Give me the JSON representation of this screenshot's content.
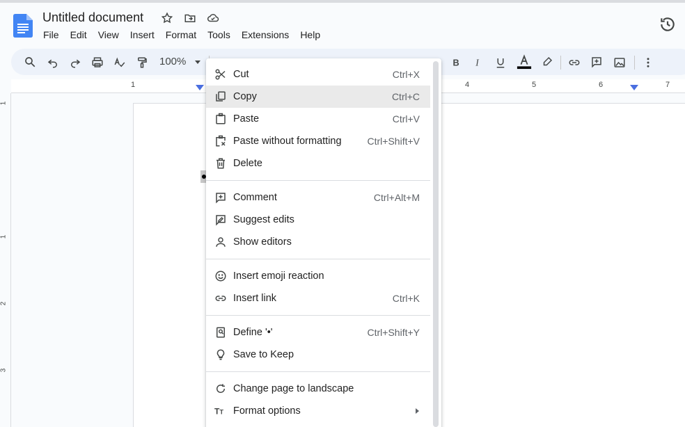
{
  "document": {
    "title": "Untitled document"
  },
  "menubar": [
    "File",
    "Edit",
    "View",
    "Insert",
    "Format",
    "Tools",
    "Extensions",
    "Help"
  ],
  "toolbar": {
    "zoom": "100%"
  },
  "ruler": {
    "numbers": [
      "1",
      "4",
      "5",
      "6",
      "7"
    ],
    "vnumbers": [
      "1",
      "1",
      "2",
      "3"
    ]
  },
  "context_menu": {
    "items": [
      {
        "label": "Cut",
        "shortcut": "Ctrl+X",
        "icon": "scissors-icon"
      },
      {
        "label": "Copy",
        "shortcut": "Ctrl+C",
        "icon": "copy-icon"
      },
      {
        "label": "Paste",
        "shortcut": "Ctrl+V",
        "icon": "paste-icon"
      },
      {
        "label": "Paste without formatting",
        "shortcut": "Ctrl+Shift+V",
        "icon": "paste-plain-icon"
      },
      {
        "label": "Delete",
        "shortcut": "",
        "icon": "trash-icon"
      },
      {
        "label": "Comment",
        "shortcut": "Ctrl+Alt+M",
        "icon": "add-comment-icon"
      },
      {
        "label": "Suggest edits",
        "shortcut": "",
        "icon": "suggest-edit-icon"
      },
      {
        "label": "Show editors",
        "shortcut": "",
        "icon": "person-icon"
      },
      {
        "label": "Insert emoji reaction",
        "shortcut": "",
        "icon": "emoji-icon"
      },
      {
        "label": "Insert link",
        "shortcut": "Ctrl+K",
        "icon": "link-icon"
      },
      {
        "label": "Define '•'",
        "shortcut": "Ctrl+Shift+Y",
        "icon": "dictionary-icon"
      },
      {
        "label": "Save to Keep",
        "shortcut": "",
        "icon": "lightbulb-icon"
      },
      {
        "label": "Change page to landscape",
        "shortcut": "",
        "icon": "rotate-icon"
      },
      {
        "label": "Format options",
        "shortcut": "",
        "icon": "text-format-icon"
      }
    ]
  }
}
